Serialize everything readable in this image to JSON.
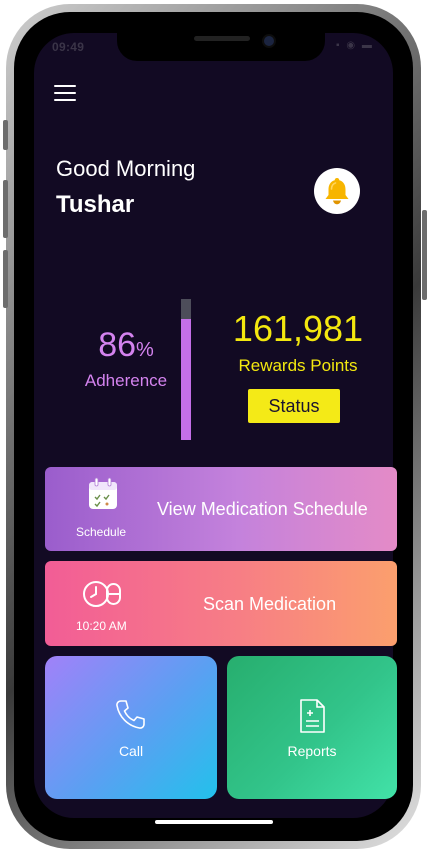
{
  "status_bar": {
    "time": "09:49",
    "icons": "▪ ◉ ▬"
  },
  "header": {
    "greeting": "Good Morning",
    "user_name": "Tushar"
  },
  "adherence": {
    "value": "86",
    "unit": "%",
    "label": "Adherence",
    "percent": 86
  },
  "rewards": {
    "points": "161,981",
    "label": "Rewards Points",
    "status_button": "Status"
  },
  "actions": {
    "schedule": {
      "icon_label": "Schedule",
      "title": "View Medication Schedule"
    },
    "scan": {
      "time": "10:20 AM",
      "title": "Scan Medication"
    },
    "call": {
      "label": "Call"
    },
    "reports": {
      "label": "Reports"
    }
  },
  "colors": {
    "background": "#120a23",
    "accent_purple": "#d483ef",
    "accent_yellow": "#f3e80f",
    "bell": "#f7b500"
  },
  "icons": {
    "menu": "hamburger-menu-icon",
    "bell": "bell-icon",
    "calendar": "calendar-icon",
    "pill_clock": "pill-clock-icon",
    "phone": "phone-icon",
    "document": "document-icon"
  }
}
